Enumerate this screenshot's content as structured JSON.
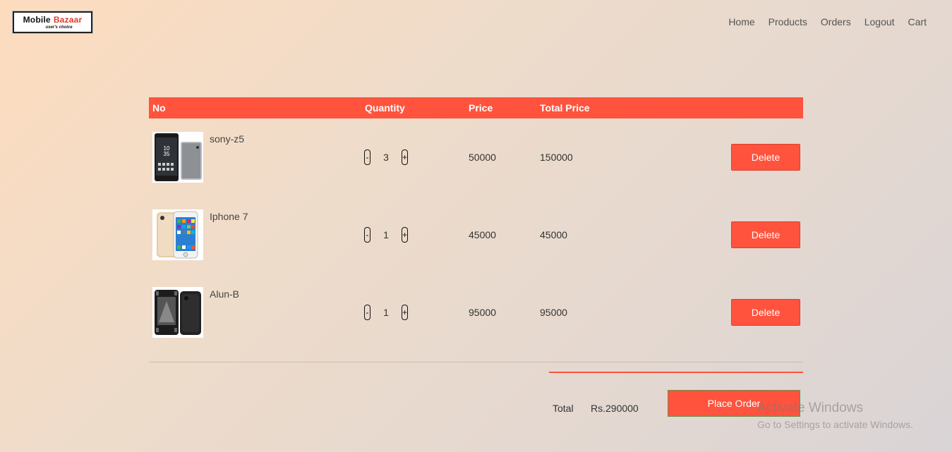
{
  "logo": {
    "brand1": "Mobile",
    "brand2": "Bazaar",
    "tagline": "user's choice"
  },
  "nav": [
    "Home",
    "Products",
    "Orders",
    "Logout",
    "Cart"
  ],
  "table": {
    "headers": {
      "no": "No",
      "quantity": "Quantity",
      "price": "Price",
      "total_price": "Total Price"
    },
    "rows": [
      {
        "name": "sony-z5",
        "quantity": "3",
        "price": "50000",
        "total": "150000",
        "delete_label": "Delete",
        "decrement": "-",
        "increment": "+"
      },
      {
        "name": "Iphone 7",
        "quantity": "1",
        "price": "45000",
        "total": "45000",
        "delete_label": "Delete",
        "decrement": "-",
        "increment": "+"
      },
      {
        "name": "Alun-B",
        "quantity": "1",
        "price": "95000",
        "total": "95000",
        "delete_label": "Delete",
        "decrement": "-",
        "increment": "+"
      }
    ]
  },
  "summary": {
    "total_label": "Total",
    "total_value": "Rs.290000",
    "place_order_label": "Place Order"
  },
  "watermark": {
    "line1": "Activate Windows",
    "line2": "Go to Settings to activate Windows."
  },
  "colors": {
    "accent": "#ff533d"
  }
}
